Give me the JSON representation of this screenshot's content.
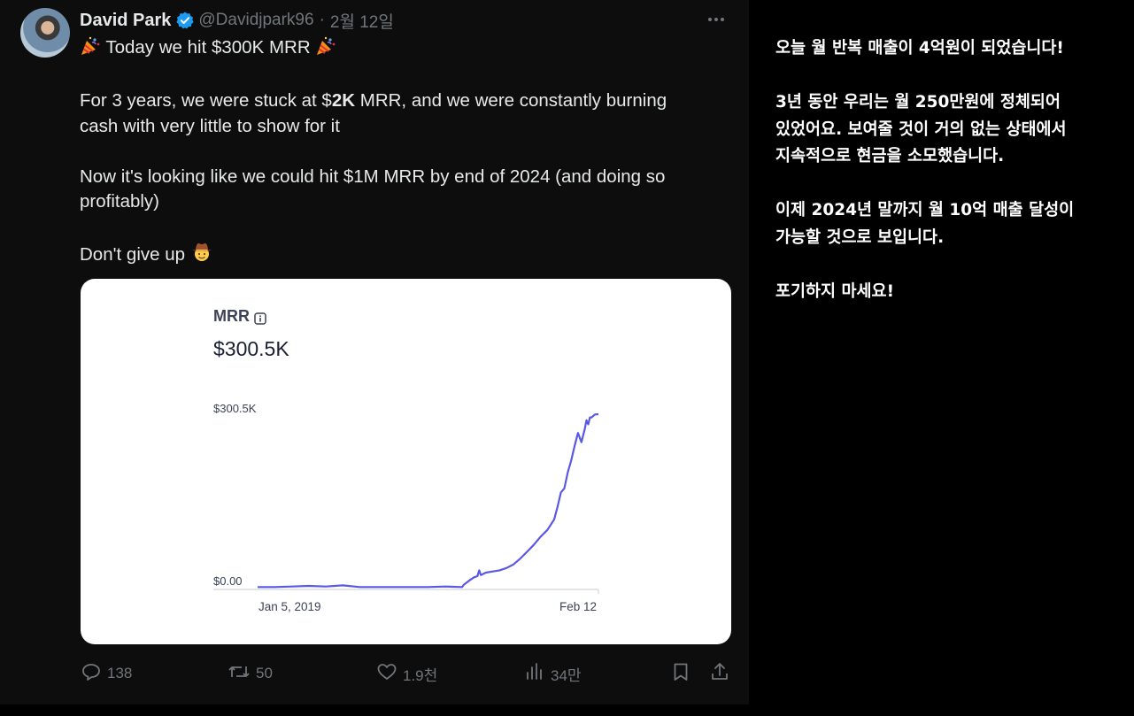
{
  "tweet": {
    "display_name": "David Park",
    "handle": "@Davidjpark96",
    "separator": "·",
    "date": "2월 12일",
    "lines": {
      "l1_pre": "",
      "l1_main": "Today we hit $300K MRR",
      "l2a": "For 3 years, we were stuck at $",
      "l2b": "2K",
      "l2c": " MRR, and we were constantly burning",
      "l3": "cash with very little to show for it",
      "l4": "Now it's looking like we could hit $1M MRR by end of 2024 (and doing so",
      "l5": "profitably)",
      "l6": "Don't give up"
    },
    "icons": {
      "avatar": "avatar",
      "verified": "verified-badge-icon",
      "more": "more-icon",
      "party": "party-popper-emoji",
      "cowboy": "cowboy-emoji"
    }
  },
  "card": {
    "title": "MRR",
    "value": "$300.5K",
    "y_top_label": "$300.5K",
    "y_bottom_label": "$0.00",
    "x_start_label": "Jan 5, 2019",
    "x_end_label": "Feb 12"
  },
  "chart_data": {
    "type": "line",
    "title": "MRR",
    "x_tick_labels": [
      "Jan 5, 2019",
      "Feb 12"
    ],
    "y_tick_labels": [
      "$0.00",
      "$300.5K"
    ],
    "ylim": [
      0,
      300.5
    ],
    "y_unit": "$K",
    "grid": false,
    "color": "#5a58e4",
    "series": [
      {
        "x_fraction": [
          0,
          0.05,
          0.1,
          0.15,
          0.2,
          0.25,
          0.3,
          0.35,
          0.4,
          0.45,
          0.5,
          0.55,
          0.6,
          0.605,
          0.62,
          0.635,
          0.645,
          0.65,
          0.655,
          0.67,
          0.69,
          0.71,
          0.73,
          0.75,
          0.77,
          0.79,
          0.81,
          0.83,
          0.85,
          0.87,
          0.88,
          0.89,
          0.9,
          0.91,
          0.92,
          0.93,
          0.94,
          0.95,
          0.96,
          0.965,
          0.97,
          0.975,
          0.98,
          0.99,
          1.0
        ],
        "values": [
          1,
          1,
          2,
          3,
          2,
          4,
          1,
          1,
          1,
          1,
          1,
          2,
          1,
          5,
          12,
          18,
          20,
          30,
          22,
          26,
          28,
          30,
          34,
          40,
          50,
          62,
          74,
          88,
          100,
          118,
          140,
          165,
          172,
          200,
          220,
          245,
          268,
          252,
          275,
          290,
          283,
          295,
          295,
          300,
          300.5
        ]
      }
    ]
  },
  "actions": {
    "replies": "138",
    "reposts": "50",
    "likes": "1.9천",
    "views": "34만"
  },
  "translation": {
    "p1": "오늘 월 반복 매출이 4억원이 되었습니다!",
    "p2a": "3년 동안 우리는 월 250만원에 정체되어",
    "p2b": "있었어요. 보여줄 것이 거의 없는 상태에서",
    "p2c": "지속적으로 현금을 소모했습니다.",
    "p3a": "이제 2024년 말까지 월 10억 매출 달성이",
    "p3b": "가능할 것으로 보입니다.",
    "p4": "포기하지 마세요!"
  }
}
